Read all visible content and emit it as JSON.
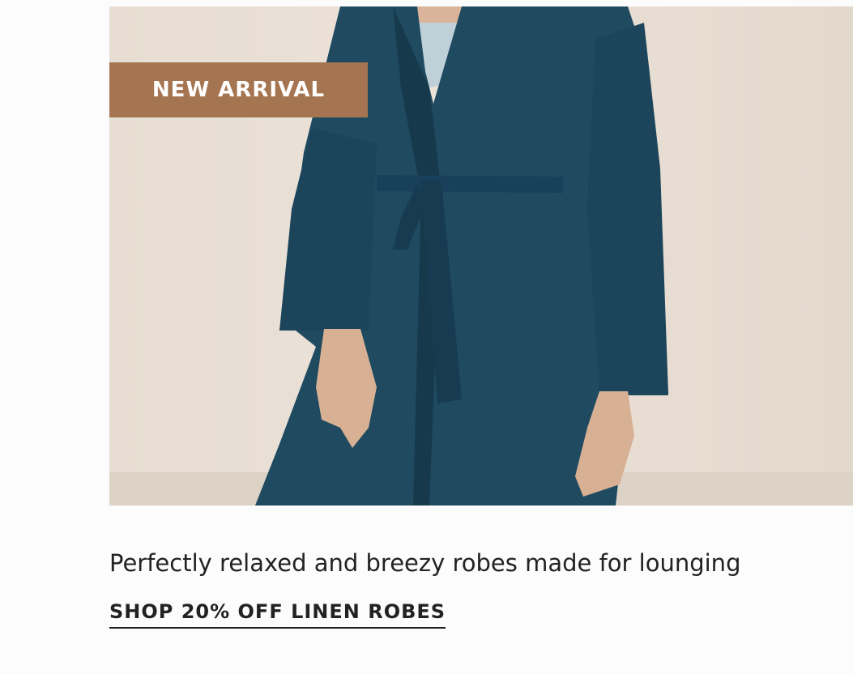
{
  "hero": {
    "image_subject": "Model wearing a navy linen robe with a tie belt",
    "robe_color": "#1f4a60",
    "background_color": "#e9dfd4"
  },
  "badge": {
    "label": "NEW ARRIVAL",
    "color": "#a57552"
  },
  "promo": {
    "tagline": "Perfectly relaxed and breezy robes made for lounging",
    "cta_label": "SHOP 20% OFF LINEN ROBES"
  }
}
